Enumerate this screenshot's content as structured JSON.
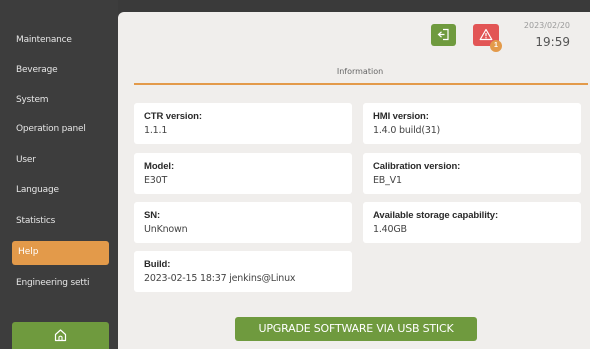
{
  "sidebar": {
    "items": [
      {
        "label": "Maintenance"
      },
      {
        "label": "Beverage"
      },
      {
        "label": "System"
      },
      {
        "label": "Operation panel"
      },
      {
        "label": "User"
      },
      {
        "label": "Language"
      },
      {
        "label": "Statistics"
      },
      {
        "label": "Help"
      },
      {
        "label": "Engineering setti"
      }
    ],
    "active_item": "Help",
    "home_icon": "home-icon"
  },
  "header": {
    "exit_icon": "exit-icon",
    "alarm_icon": "warning-icon",
    "alarm_count": "1",
    "date": "2023/02/20",
    "time": "19:59"
  },
  "section": {
    "title": "Information"
  },
  "info_cards": {
    "ctr": {
      "label": "CTR version:",
      "value": "1.1.1"
    },
    "hmi": {
      "label": "HMI version:",
      "value": "1.4.0 build(31)"
    },
    "model": {
      "label": "Model:",
      "value": "E30T"
    },
    "calibration": {
      "label": "Calibration version:",
      "value": "EB_V1"
    },
    "sn": {
      "label": "SN:",
      "value": "UnKnown"
    },
    "storage": {
      "label": "Available storage capability:",
      "value": "1.40GB"
    },
    "build": {
      "label": "Build:",
      "value": "2023-02-15 18:37 jenkins@Linux"
    }
  },
  "actions": {
    "upgrade_label": "UPGRADE SOFTWARE VIA USB STICK"
  },
  "colors": {
    "accent_orange": "#e39a4a",
    "button_green": "#6f9a3e",
    "alarm_red": "#e25555",
    "sidebar_bg": "#3d3d3d",
    "panel_bg": "#f0eeec"
  }
}
